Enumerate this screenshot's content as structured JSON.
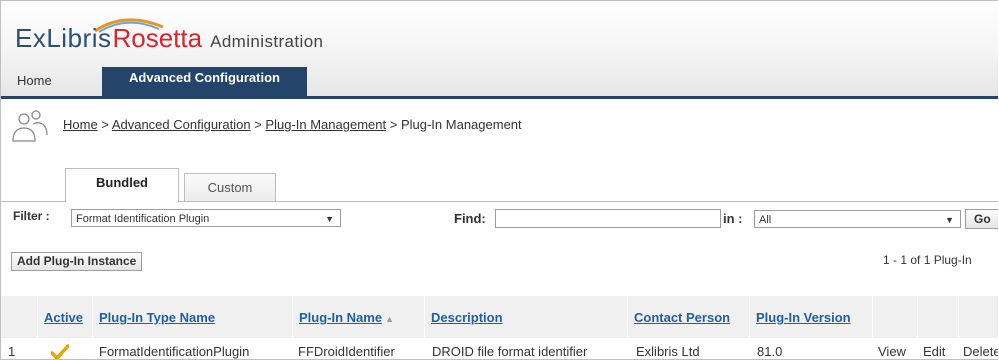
{
  "header": {
    "brand_exlibris": "ExLibris",
    "brand_rosetta": "Rosetta",
    "brand_admin": "Administration",
    "colors": {
      "navy": "#24446a",
      "red": "#d7262e",
      "link": "#1f5fa6"
    }
  },
  "nav": {
    "home": "Home",
    "advanced": "Advanced Configuration"
  },
  "breadcrumb": {
    "items": [
      "Home",
      "Advanced Configuration",
      "Plug-In Management"
    ],
    "separator": ">",
    "current": "Plug-In Management",
    "icon": "users-icon"
  },
  "subtabs": {
    "bundled": "Bundled",
    "custom": "Custom"
  },
  "filter": {
    "label": "Filter :",
    "value": "Format Identification Plugin",
    "find_label": "Find:",
    "find_value": "",
    "in_label": "in :",
    "in_value": "All",
    "go": "Go"
  },
  "actions": {
    "add": "Add Plug-In Instance",
    "count": "1 - 1 of 1 Plug-In"
  },
  "table": {
    "headers": [
      "Active",
      "Plug-In Type Name",
      "Plug-In Name",
      "Description",
      "Contact Person",
      "Plug-In Version"
    ],
    "sort_indicator": "▲",
    "rows": [
      {
        "index": "1",
        "active_icon": "checkmark-icon",
        "type_name": "FormatIdentificationPlugin",
        "name": "FFDroidIdentifier",
        "description": "DROID file format identifier",
        "contact": "Exlibris Ltd",
        "version": "81.0",
        "view": "View",
        "edit": "Edit",
        "delete": "Delete"
      }
    ]
  }
}
